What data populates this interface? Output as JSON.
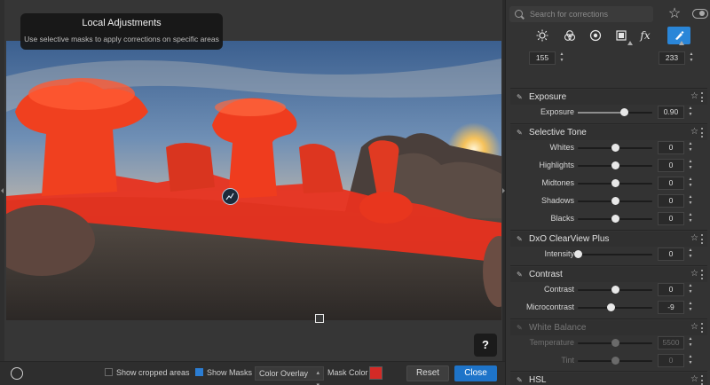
{
  "tooltip": {
    "title": "Local Adjustments",
    "subtitle": "Use selective masks to apply corrections on specific areas"
  },
  "help_label": "?",
  "bottom_bar": {
    "show_cropped": "Show cropped areas",
    "show_masks": "Show Masks",
    "overlay_mode": "Color Overlay",
    "mask_color_label": "Mask Color",
    "mask_color": "#d42a26",
    "reset": "Reset",
    "close": "Close"
  },
  "search": {
    "placeholder": "Search for corrections"
  },
  "tabs": [
    "sun-icon",
    "color-circles-icon",
    "detail-icon",
    "geometry-icon",
    "fx-icon",
    "local-adjust-brush-icon"
  ],
  "tabs_fx_label": "fx",
  "top_values": {
    "left": "155",
    "right": "233"
  },
  "sections": {
    "exposure": {
      "title": "Exposure",
      "rows": [
        {
          "label": "Exposure",
          "value": "0.90",
          "level": 0.62
        }
      ]
    },
    "selective_tone": {
      "title": "Selective Tone",
      "rows": [
        {
          "label": "Whites",
          "value": "0",
          "level": 0.5
        },
        {
          "label": "Highlights",
          "value": "0",
          "level": 0.5
        },
        {
          "label": "Midtones",
          "value": "0",
          "level": 0.5
        },
        {
          "label": "Shadows",
          "value": "0",
          "level": 0.5
        },
        {
          "label": "Blacks",
          "value": "0",
          "level": 0.5
        }
      ]
    },
    "clearview": {
      "title": "DxO ClearView Plus",
      "rows": [
        {
          "label": "Intensity",
          "value": "0",
          "level": 0.0
        }
      ]
    },
    "contrast": {
      "title": "Contrast",
      "rows": [
        {
          "label": "Contrast",
          "value": "0",
          "level": 0.5
        },
        {
          "label": "Microcontrast",
          "value": "-9",
          "level": 0.45
        }
      ]
    },
    "white_balance": {
      "title": "White Balance",
      "rows": [
        {
          "label": "Temperature",
          "value": "5500",
          "level": 0.5
        },
        {
          "label": "Tint",
          "value": "0",
          "level": 0.5
        }
      ]
    },
    "hsl": {
      "title": "HSL"
    }
  },
  "colors": {
    "accent": "#1e74c9",
    "mask_overlay": "#e8321f"
  }
}
